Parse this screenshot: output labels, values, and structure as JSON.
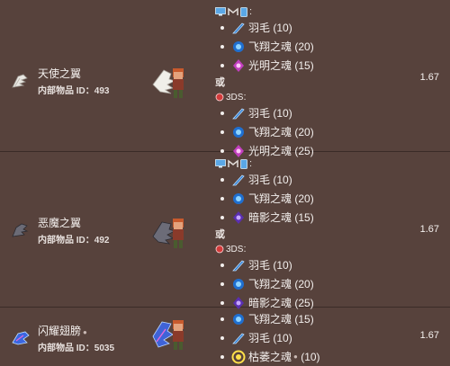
{
  "rows": [
    {
      "name": "天使之翼",
      "id_prefix": "内部物品 ID：",
      "id_value": "493",
      "value": "1.67",
      "recipes": [
        {
          "platform_label": "",
          "ingredients": [
            {
              "name": "羽毛",
              "count": "(10)",
              "icon": "feather-icon"
            },
            {
              "name": "飞翔之魂",
              "count": "(20)",
              "icon": "soul-of-flight-icon"
            },
            {
              "name": "光明之魂",
              "count": "(15)",
              "icon": "soul-of-light-icon"
            }
          ]
        },
        {
          "platform_label": "3DS",
          "ingredients": [
            {
              "name": "羽毛",
              "count": "(10)",
              "icon": "feather-icon"
            },
            {
              "name": "飞翔之魂",
              "count": "(20)",
              "icon": "soul-of-flight-icon"
            },
            {
              "name": "光明之魂",
              "count": "(25)",
              "icon": "soul-of-light-icon"
            }
          ]
        }
      ]
    },
    {
      "name": "恶魔之翼",
      "id_prefix": "内部物品 ID：",
      "id_value": "492",
      "value": "1.67",
      "recipes": [
        {
          "platform_label": "",
          "ingredients": [
            {
              "name": "羽毛",
              "count": "(10)",
              "icon": "feather-icon"
            },
            {
              "name": "飞翔之魂",
              "count": "(20)",
              "icon": "soul-of-flight-icon"
            },
            {
              "name": "暗影之魂",
              "count": "(15)",
              "icon": "soul-of-night-icon"
            }
          ]
        },
        {
          "platform_label": "3DS",
          "ingredients": [
            {
              "name": "羽毛",
              "count": "(10)",
              "icon": "feather-icon"
            },
            {
              "name": "飞翔之魂",
              "count": "(20)",
              "icon": "soul-of-flight-icon"
            },
            {
              "name": "暗影之魂",
              "count": "(25)",
              "icon": "soul-of-night-icon"
            }
          ]
        }
      ]
    },
    {
      "name": "闪耀翅膀",
      "id_prefix": "内部物品 ID：",
      "id_value": "5035",
      "value": "1.67",
      "ingredients": [
        {
          "name": "飞翔之魂",
          "count": "(15)",
          "icon": "soul-of-flight-icon"
        },
        {
          "name": "羽毛",
          "count": "(10)",
          "icon": "feather-icon"
        },
        {
          "name": "枯萎之魂",
          "count": "(10)",
          "icon": "soul-of-blight-icon"
        }
      ]
    }
  ],
  "or_label": "或",
  "colors": {
    "background": "#57423c",
    "id_highlight": "#8fd4ff",
    "row_divider": "#3a2b27"
  }
}
